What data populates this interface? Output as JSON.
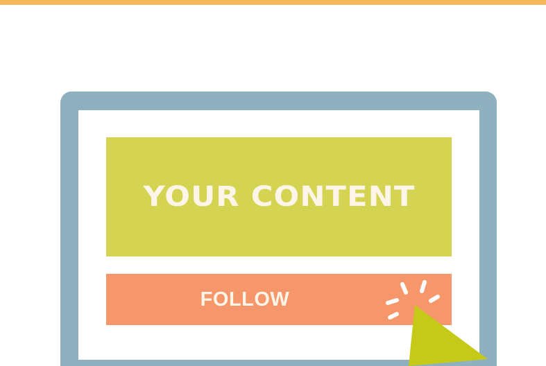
{
  "content": {
    "label": "YOUR CONTENT"
  },
  "follow_button": {
    "label": "FOLLOW"
  },
  "colors": {
    "accent_rule": "#f5b85c",
    "frame": "#8fb1bf",
    "content_block": "#d4d452",
    "follow_button": "#f5976a",
    "cursor": "#c5c918",
    "text_light": "#fdf5e8"
  },
  "icons": {
    "cursor": "cursor-arrow-icon",
    "click": "click-burst-icon"
  }
}
